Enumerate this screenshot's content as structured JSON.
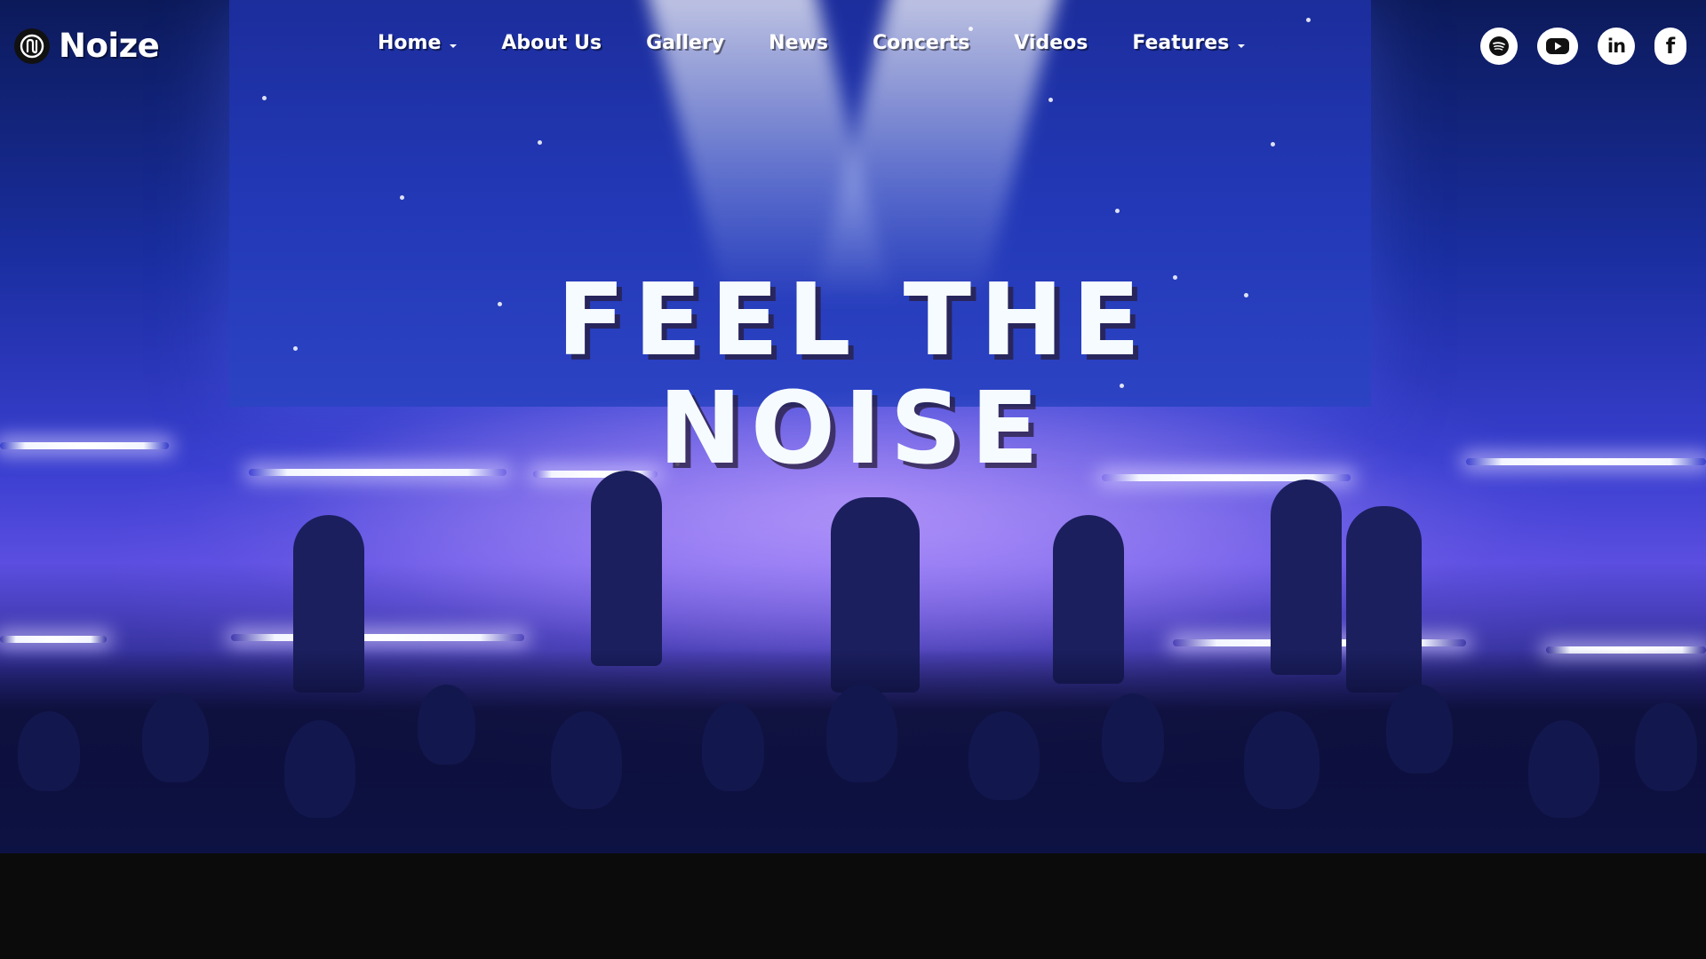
{
  "brand": {
    "name": "Noize",
    "icon": "noize-logo-icon"
  },
  "nav": {
    "items": [
      {
        "label": "Home",
        "has_dropdown": true
      },
      {
        "label": "About Us",
        "has_dropdown": false
      },
      {
        "label": "Gallery",
        "has_dropdown": false
      },
      {
        "label": "News",
        "has_dropdown": false
      },
      {
        "label": "Concerts",
        "has_dropdown": false
      },
      {
        "label": "Videos",
        "has_dropdown": false
      },
      {
        "label": "Features",
        "has_dropdown": true
      }
    ]
  },
  "socials": [
    {
      "name": "spotify-icon"
    },
    {
      "name": "youtube-icon"
    },
    {
      "name": "linkedin-icon",
      "label": "in"
    },
    {
      "name": "facebook-icon",
      "label": "f"
    }
  ],
  "hero": {
    "headline_line1": "FEEL THE",
    "headline_line2": "NOISE"
  },
  "colors": {
    "hero_blue": "#2238b6",
    "hero_purple": "#5b4ee0",
    "footer_bg": "#0b0b0b",
    "text": "#ffffff"
  }
}
